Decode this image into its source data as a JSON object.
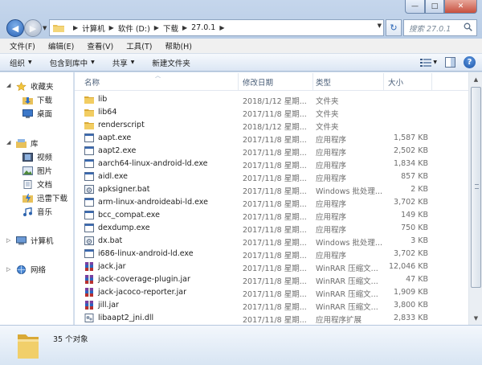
{
  "window": {
    "min_label": "—",
    "max_label": "□",
    "close_label": "✕"
  },
  "address": {
    "breadcrumbs": [
      "计算机",
      "软件 (D:)",
      "下载",
      "27.0.1"
    ],
    "search_placeholder": "搜索 27.0.1"
  },
  "menu": [
    "文件(F)",
    "编辑(E)",
    "查看(V)",
    "工具(T)",
    "帮助(H)"
  ],
  "toolbar": {
    "organize": "组织",
    "include_in_library": "包含到库中",
    "share": "共享",
    "new_folder": "新建文件夹"
  },
  "nav": {
    "favorites": "收藏夹",
    "downloads": "下载",
    "desktop": "桌面",
    "libraries": "库",
    "videos": "视频",
    "pictures": "图片",
    "documents": "文档",
    "thunder": "迅雷下载",
    "music": "音乐",
    "computer": "计算机",
    "network": "网络"
  },
  "columns": {
    "name": "名称",
    "date": "修改日期",
    "type": "类型",
    "size": "大小"
  },
  "files": [
    {
      "icon": "folder-icon",
      "name": "lib",
      "date": "2018/1/12 星期...",
      "type": "文件夹",
      "size": ""
    },
    {
      "icon": "folder-icon",
      "name": "lib64",
      "date": "2017/11/8 星期...",
      "type": "文件夹",
      "size": ""
    },
    {
      "icon": "folder-icon",
      "name": "renderscript",
      "date": "2018/1/12 星期...",
      "type": "文件夹",
      "size": ""
    },
    {
      "icon": "exe-icon",
      "name": "aapt.exe",
      "date": "2017/11/8 星期...",
      "type": "应用程序",
      "size": "1,587 KB"
    },
    {
      "icon": "exe-icon",
      "name": "aapt2.exe",
      "date": "2017/11/8 星期...",
      "type": "应用程序",
      "size": "2,502 KB"
    },
    {
      "icon": "exe-icon",
      "name": "aarch64-linux-android-ld.exe",
      "date": "2017/11/8 星期...",
      "type": "应用程序",
      "size": "1,834 KB"
    },
    {
      "icon": "exe-icon",
      "name": "aidl.exe",
      "date": "2017/11/8 星期...",
      "type": "应用程序",
      "size": "857 KB"
    },
    {
      "icon": "bat-icon",
      "name": "apksigner.bat",
      "date": "2017/11/8 星期...",
      "type": "Windows 批处理...",
      "size": "2 KB"
    },
    {
      "icon": "exe-icon",
      "name": "arm-linux-androideabi-ld.exe",
      "date": "2017/11/8 星期...",
      "type": "应用程序",
      "size": "3,702 KB"
    },
    {
      "icon": "exe-icon",
      "name": "bcc_compat.exe",
      "date": "2017/11/8 星期...",
      "type": "应用程序",
      "size": "149 KB"
    },
    {
      "icon": "exe-icon",
      "name": "dexdump.exe",
      "date": "2017/11/8 星期...",
      "type": "应用程序",
      "size": "750 KB"
    },
    {
      "icon": "bat-icon",
      "name": "dx.bat",
      "date": "2017/11/8 星期...",
      "type": "Windows 批处理...",
      "size": "3 KB"
    },
    {
      "icon": "exe-icon",
      "name": "i686-linux-android-ld.exe",
      "date": "2017/11/8 星期...",
      "type": "应用程序",
      "size": "3,702 KB"
    },
    {
      "icon": "jar-icon",
      "name": "jack.jar",
      "date": "2017/11/8 星期...",
      "type": "WinRAR 压缩文...",
      "size": "12,046 KB"
    },
    {
      "icon": "jar-icon",
      "name": "jack-coverage-plugin.jar",
      "date": "2017/11/8 星期...",
      "type": "WinRAR 压缩文...",
      "size": "47 KB"
    },
    {
      "icon": "jar-icon",
      "name": "jack-jacoco-reporter.jar",
      "date": "2017/11/8 星期...",
      "type": "WinRAR 压缩文...",
      "size": "1,909 KB"
    },
    {
      "icon": "jar-icon",
      "name": "jill.jar",
      "date": "2017/11/8 星期...",
      "type": "WinRAR 压缩文...",
      "size": "3,800 KB"
    },
    {
      "icon": "dll-icon",
      "name": "libaapt2_jni.dll",
      "date": "2017/11/8 星期...",
      "type": "应用程序扩展",
      "size": "2,833 KB"
    }
  ],
  "details": {
    "count": "35 个对象"
  }
}
